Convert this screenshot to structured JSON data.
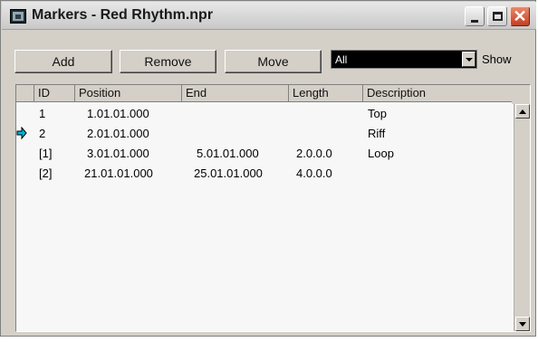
{
  "window": {
    "title": "Markers - Red Rhythm.npr",
    "minimize_icon": "minimize-icon",
    "maximize_icon": "maximize-icon",
    "close_icon": "close-icon",
    "close_glyph": "✕"
  },
  "toolbar": {
    "add_label": "Add",
    "remove_label": "Remove",
    "move_label": "Move",
    "filter_value": "All",
    "show_label": "Show"
  },
  "list": {
    "columns": [
      "ID",
      "Position",
      "End",
      "Length",
      "Description"
    ],
    "rows": [
      {
        "id": "1",
        "position": "1.01.01.000",
        "end": "",
        "length": "",
        "description": "Top",
        "current": false
      },
      {
        "id": "2",
        "position": "2.01.01.000",
        "end": "",
        "length": "",
        "description": "Riff",
        "current": true
      },
      {
        "id": "[1]",
        "position": "3.01.01.000",
        "end": "5.01.01.000",
        "length": "2.0.0.0",
        "description": "Loop",
        "current": false
      },
      {
        "id": "[2]",
        "position": "21.01.01.000",
        "end": "25.01.01.000",
        "length": "4.0.0.0",
        "description": "",
        "current": false
      }
    ]
  },
  "colors": {
    "current_marker_arrow": "#00b4d8",
    "dialog_bg": "#d4d0c8",
    "list_bg": "#f7f7f7",
    "combo_bg": "#000000"
  }
}
